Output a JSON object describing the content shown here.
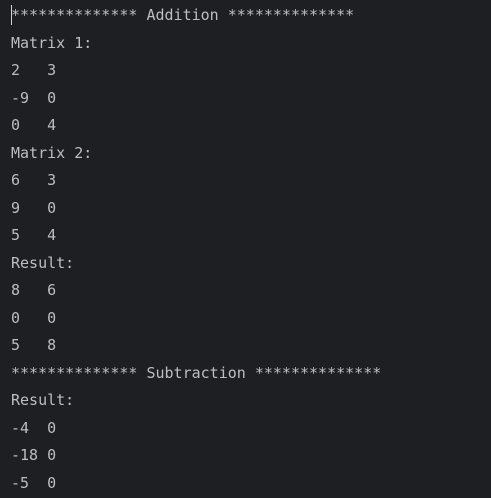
{
  "console": {
    "lines": [
      "************** Addition **************",
      "Matrix 1:",
      "2   3",
      "-9  0",
      "0   4",
      "Matrix 2:",
      "6   3",
      "9   0",
      "5   4",
      "Result:",
      "8   6",
      "0   0",
      "5   8",
      "************** Subtraction **************",
      "Result:",
      "-4  0",
      "-18 0",
      "-5  0"
    ]
  },
  "colors": {
    "background": "#1e1f22",
    "text": "#bcbec4"
  }
}
